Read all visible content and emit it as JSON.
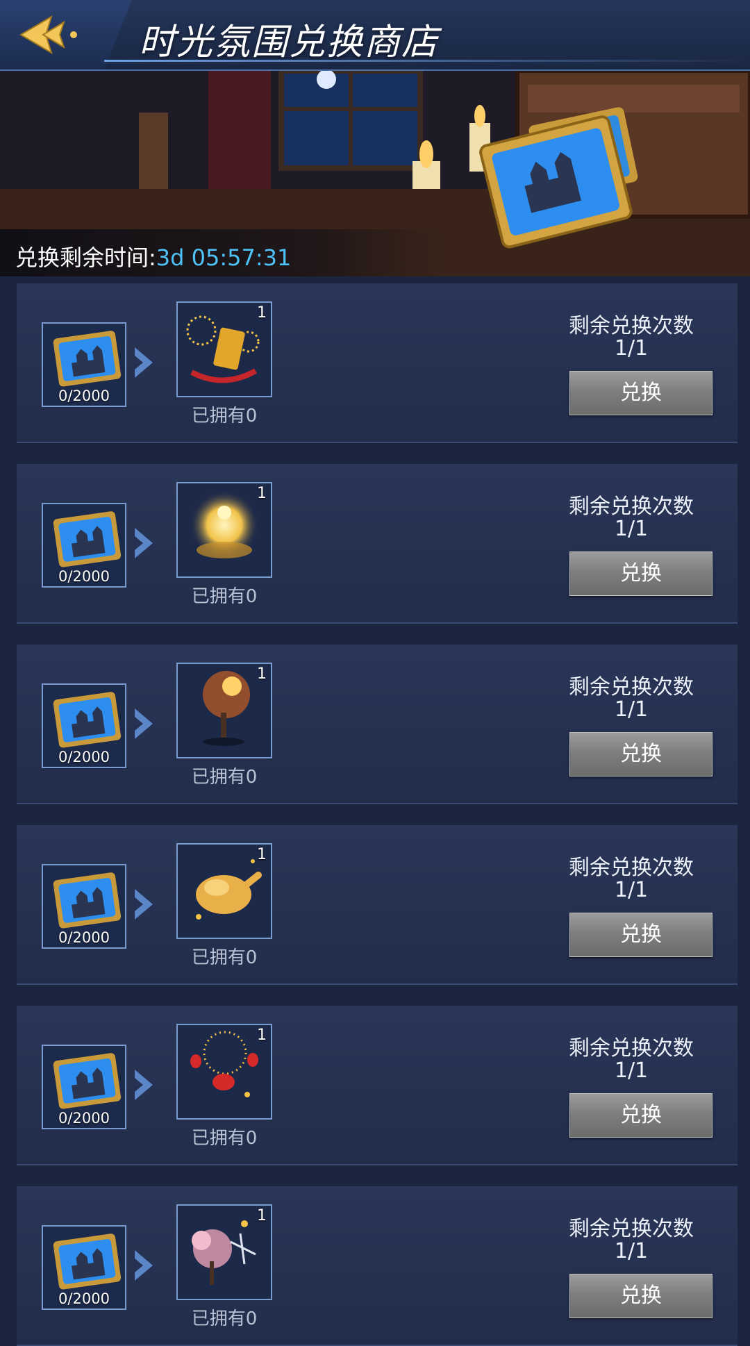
{
  "header": {
    "title": "时光氛围兑换商店",
    "back_icon": "back-arrow-icon"
  },
  "banner": {
    "timer_label": "兑换剩余时间:",
    "timer_value": "3d 05:57:31"
  },
  "rows": [
    {
      "cost": "0/2000",
      "reward_qty": "1",
      "owned": "已拥有0",
      "remain_label": "剩余兑换次数",
      "remain_count": "1/1",
      "button": "兑换",
      "reward_icon": "fireworks-gift-icon"
    },
    {
      "cost": "0/2000",
      "reward_qty": "1",
      "owned": "已拥有0",
      "remain_label": "剩余兑换次数",
      "remain_count": "1/1",
      "button": "兑换",
      "reward_icon": "golden-glow-icon"
    },
    {
      "cost": "0/2000",
      "reward_qty": "1",
      "owned": "已拥有0",
      "remain_label": "剩余兑换次数",
      "remain_count": "1/1",
      "button": "兑换",
      "reward_icon": "autumn-tree-icon"
    },
    {
      "cost": "0/2000",
      "reward_qty": "1",
      "owned": "已拥有0",
      "remain_label": "剩余兑换次数",
      "remain_count": "1/1",
      "button": "兑换",
      "reward_icon": "roast-chicken-icon"
    },
    {
      "cost": "0/2000",
      "reward_qty": "1",
      "owned": "已拥有0",
      "remain_label": "剩余兑换次数",
      "remain_count": "1/1",
      "button": "兑换",
      "reward_icon": "lantern-fireworks-icon"
    },
    {
      "cost": "0/2000",
      "reward_qty": "1",
      "owned": "已拥有0",
      "remain_label": "剩余兑换次数",
      "remain_count": "1/1",
      "button": "兑换",
      "reward_icon": "cherry-blossom-icon"
    }
  ],
  "cost_icon": "castle-card-icon",
  "colors": {
    "accent": "#4fc3f7",
    "button": "#8a8a8a",
    "panel": "#2a3658"
  }
}
